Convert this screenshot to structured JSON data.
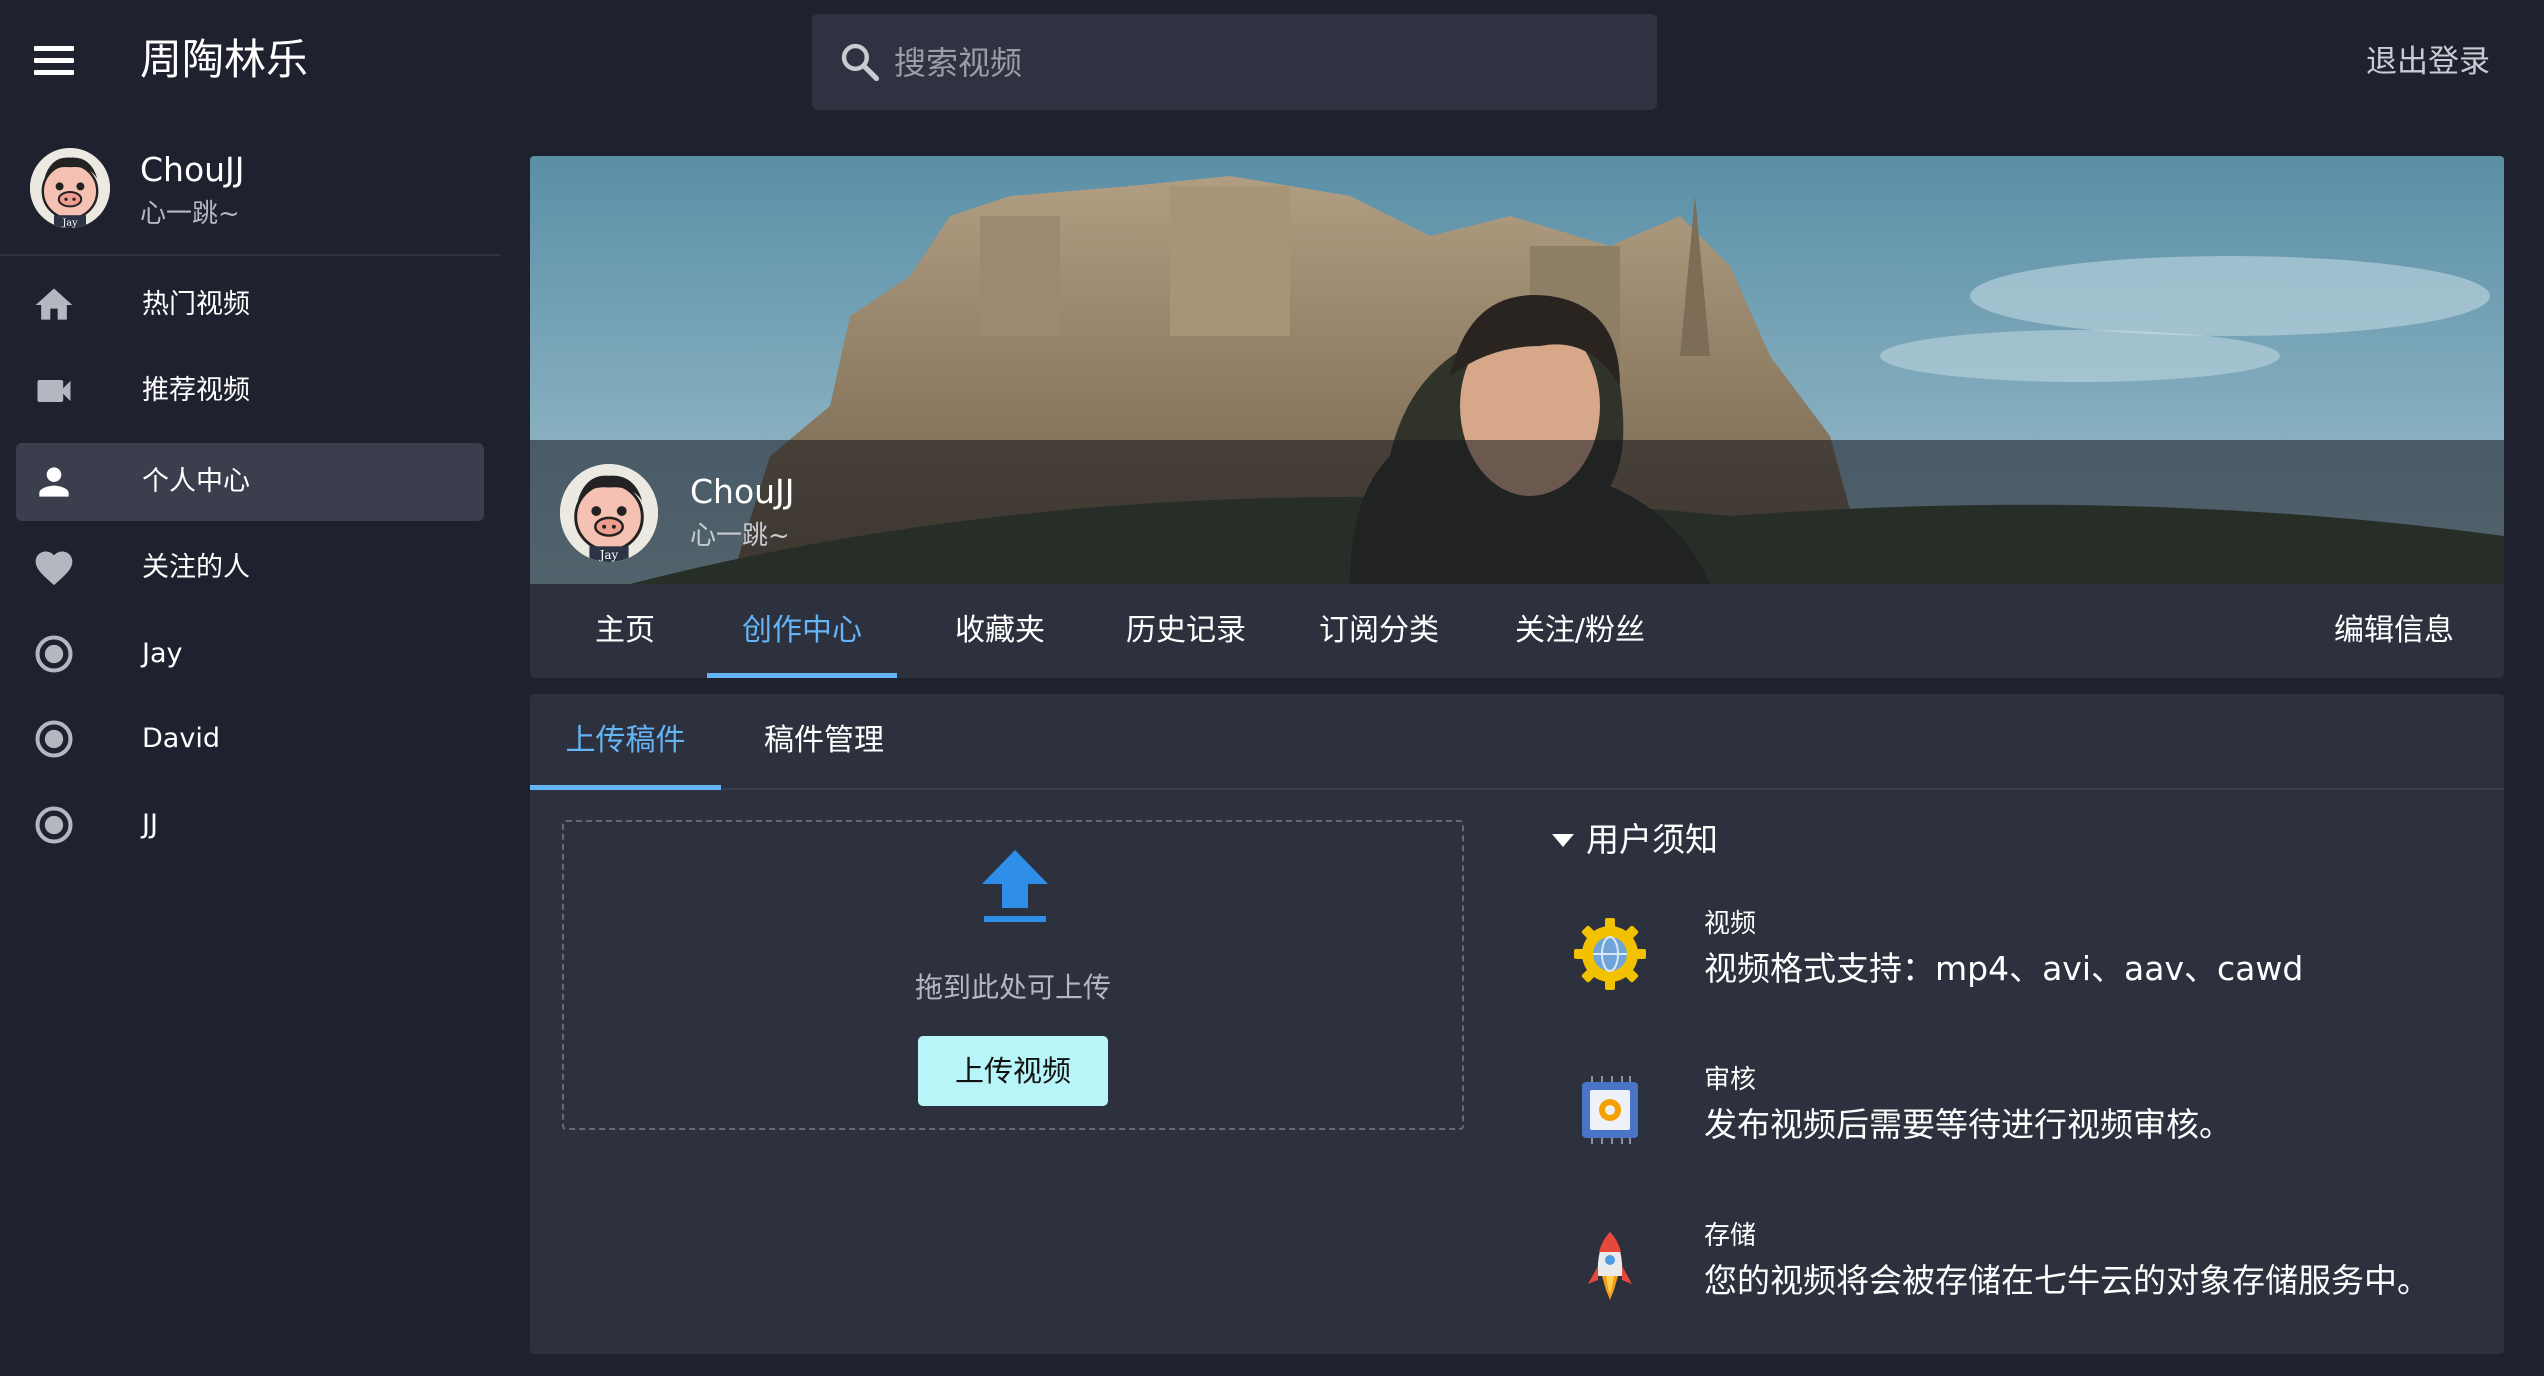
{
  "app": {
    "title": "周陶林乐"
  },
  "search": {
    "placeholder": "搜索视频"
  },
  "header": {
    "logout_label": "退出登录"
  },
  "user": {
    "name": "ChouJJ",
    "signature": "心一跳~"
  },
  "sidebar": {
    "items": [
      {
        "label": "热门视频",
        "icon": "home-icon"
      },
      {
        "label": "推荐视频",
        "icon": "video-camera-icon"
      },
      {
        "label": "个人中心",
        "icon": "person-icon",
        "active": true
      },
      {
        "label": "关注的人",
        "icon": "heart-icon"
      },
      {
        "label": "Jay",
        "icon": "radio-icon"
      },
      {
        "label": "David",
        "icon": "radio-icon"
      },
      {
        "label": "JJ",
        "icon": "radio-icon"
      }
    ]
  },
  "profile": {
    "name": "ChouJJ",
    "signature": "心一跳~",
    "tabs": [
      "主页",
      "创作中心",
      "收藏夹",
      "历史记录",
      "订阅分类",
      "关注/粉丝"
    ],
    "active_tab": "创作中心",
    "edit_label": "编辑信息"
  },
  "creation": {
    "subtabs": [
      "上传稿件",
      "稿件管理"
    ],
    "active_subtab": "上传稿件",
    "drop_hint": "拖到此处可上传",
    "upload_button": "上传视频",
    "notice": {
      "title": "用户须知",
      "items": [
        {
          "title": "视频",
          "desc": "视频格式支持：mp4、avi、aav、cawd",
          "icon": "gear-globe-icon"
        },
        {
          "title": "审核",
          "desc": "发布视频后需要等待进行视频审核。",
          "icon": "chip-gear-icon"
        },
        {
          "title": "存储",
          "desc": "您的视频将会被存储在七牛云的对象存储服务中。",
          "icon": "rocket-icon"
        }
      ]
    }
  },
  "colors": {
    "accent": "#64b5f6",
    "upload_button_bg": "#b8f5f8",
    "background": "#1f222e",
    "card": "#2d303d"
  }
}
